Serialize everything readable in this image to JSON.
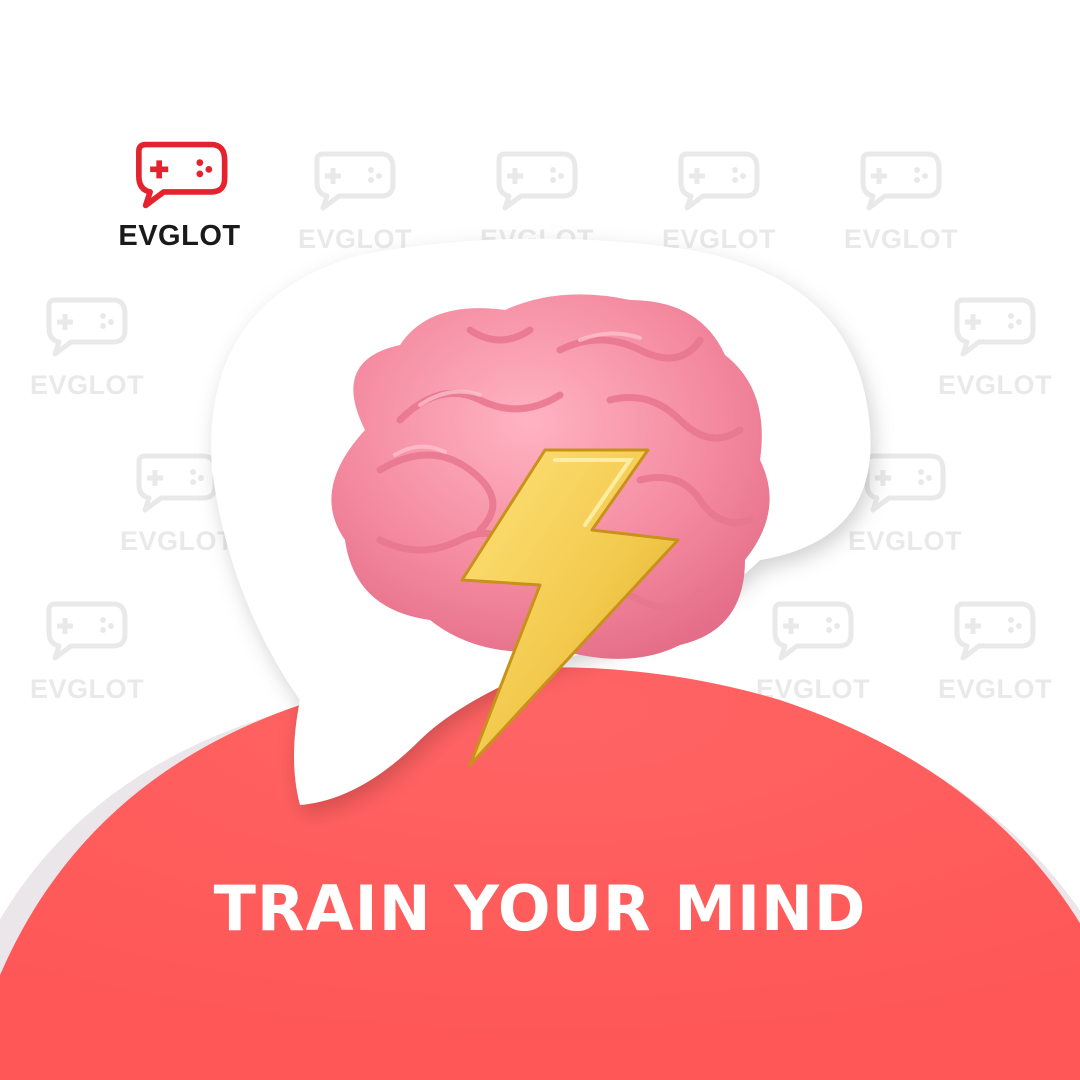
{
  "brand": {
    "name": "EVGLOT",
    "logo_icon": "gamepad-chat-icon",
    "accent_color": "#f05454"
  },
  "watermark": {
    "text": "EVGLOT",
    "icon": "gamepad-chat-icon"
  },
  "illustration": {
    "brain": "brain-illustration",
    "bolt": "lightning-bolt-icon",
    "brain_color": "#f4879d",
    "bolt_color": "#f2c94c"
  },
  "headline": {
    "text": "TRAIN YOUR MIND",
    "color": "#ffffff"
  },
  "background": {
    "base_color": "#ffffff",
    "arc_color": "#ff5a5a"
  }
}
